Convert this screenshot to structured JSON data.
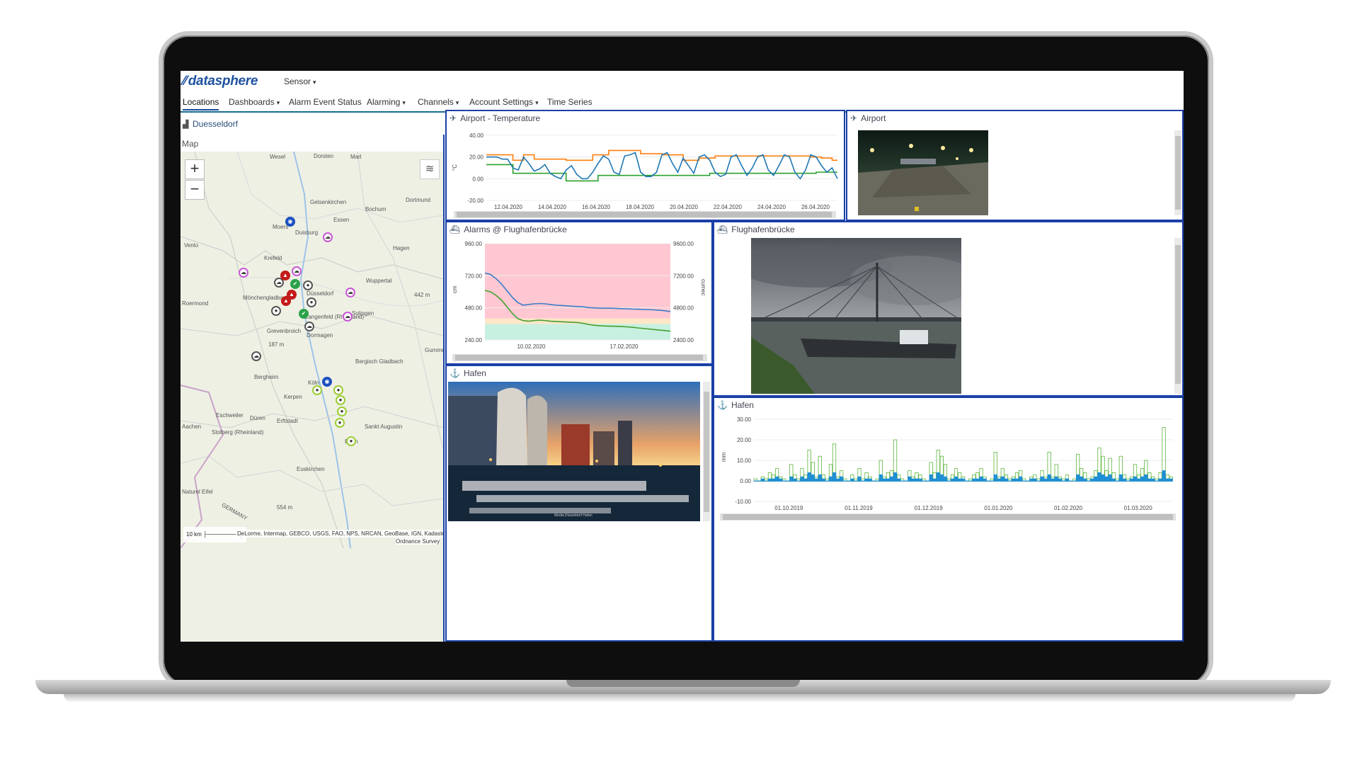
{
  "app": {
    "brand": "datasphere",
    "menu": "Sensor"
  },
  "nav": {
    "items": [
      {
        "label": "Locations"
      },
      {
        "label": "Dashboards"
      },
      {
        "label": "Alarm Event Status"
      },
      {
        "label": "Alarming"
      },
      {
        "label": "Channels"
      },
      {
        "label": "Account Settings"
      },
      {
        "label": "Time Series"
      }
    ]
  },
  "breadcrumb": {
    "location": "Duesseldorf"
  },
  "colors": {
    "accent": "#1a3fa6",
    "orange": "#ff7f0e",
    "blue": "#1f9ad6",
    "green": "#3a9a2f"
  },
  "map": {
    "title": "Map",
    "zoom_in": "+",
    "zoom_out": "−",
    "scale": "10 km",
    "attribution": "DeLorme, Intermap, GEBCO, USGS, FAO, NPS, NRCAN, GeoBase, IGN, Kadaster NL,",
    "attribution2": "Ordnance Survey",
    "places": [
      {
        "name": "Wesel"
      },
      {
        "name": "Dorsten"
      },
      {
        "name": "Marl"
      },
      {
        "name": "Gelsenkirchen"
      },
      {
        "name": "Dortmund"
      },
      {
        "name": "Essen"
      },
      {
        "name": "Bochum"
      },
      {
        "name": "Duisburg"
      },
      {
        "name": "Moers"
      },
      {
        "name": "Hagen"
      },
      {
        "name": "Krefeld"
      },
      {
        "name": "Venlo"
      },
      {
        "name": "Wuppertal"
      },
      {
        "name": "Mönchengladbach"
      },
      {
        "name": "Düsseldorf"
      },
      {
        "name": "Solingen"
      },
      {
        "name": "Langenfeld (Rheinland)"
      },
      {
        "name": "Dormagen"
      },
      {
        "name": "Grevenbroich"
      },
      {
        "name": "Bergisch Gladbach"
      },
      {
        "name": "Bergheim"
      },
      {
        "name": "Köln"
      },
      {
        "name": "Kerpen"
      },
      {
        "name": "Eschweiler"
      },
      {
        "name": "Düren"
      },
      {
        "name": "Erftstadt"
      },
      {
        "name": "Aachen"
      },
      {
        "name": "Stolberg (Rheinland)"
      },
      {
        "name": "Bonn"
      },
      {
        "name": "Sankt Augustin"
      },
      {
        "name": "Euskirchen"
      },
      {
        "name": "Gummersbach"
      },
      {
        "name": "Roermond"
      },
      {
        "name": "Naturel Eifel"
      },
      {
        "name": "GERMANY"
      },
      {
        "name": "442 m"
      },
      {
        "name": "187 m"
      },
      {
        "name": "554 m"
      }
    ]
  },
  "temperature": {
    "title": "Airport - Temperature",
    "icon": "airplane-icon"
  },
  "airport": {
    "title": "Airport",
    "icon": "airplane-icon"
  },
  "alarms": {
    "title": "Alarms @ Flughafenbrücke",
    "icon": "ship-icon"
  },
  "flughafen": {
    "title": "Flughafenbrücke",
    "icon": "ship-icon"
  },
  "hafen_image": {
    "title": "Hafen",
    "icon": "anchor-icon",
    "caption": "Media Düsseldorf Hafen"
  },
  "hafen_chart": {
    "title": "Hafen",
    "icon": "anchor-icon"
  },
  "chart_data": [
    {
      "id": "temp",
      "type": "line",
      "ylabel": "°C",
      "yticks": [
        "40.00",
        "20.00",
        "0.00",
        "-20.00"
      ],
      "ylim": [
        -20,
        40
      ],
      "xticks": [
        "12.04.2020",
        "14.04.2020",
        "16.04.2020",
        "18.04.2020",
        "20.04.2020",
        "22.04.2020",
        "24.04.2020",
        "26.04.2020"
      ],
      "series": [
        {
          "color": "#ff7f0e",
          "values": [
            22,
            22,
            22,
            22,
            22,
            17,
            17,
            22,
            22,
            18,
            18,
            18,
            18,
            18,
            18,
            17,
            17,
            17,
            17,
            17,
            22,
            22,
            22,
            26,
            26,
            26,
            26,
            26,
            26,
            23,
            23,
            23,
            23,
            22,
            22,
            22,
            22,
            17,
            17,
            17,
            19,
            19,
            19,
            21,
            21,
            21,
            21,
            21,
            21,
            21,
            21,
            21,
            21,
            21,
            21,
            21,
            21,
            21,
            21,
            21,
            21,
            20,
            20,
            19,
            19,
            17,
            17
          ]
        },
        {
          "color": "#1f77b4",
          "values": [
            20,
            20,
            20,
            18,
            18,
            10,
            8,
            20,
            14,
            7,
            9,
            13,
            5,
            2,
            0,
            8,
            12,
            4,
            0,
            0,
            6,
            14,
            21,
            18,
            6,
            4,
            21,
            22,
            24,
            6,
            2,
            2,
            6,
            22,
            24,
            14,
            6,
            19,
            12,
            5,
            20,
            22,
            17,
            6,
            2,
            4,
            20,
            22,
            12,
            3,
            10,
            20,
            22,
            8,
            3,
            12,
            22,
            20,
            6,
            0,
            8,
            22,
            20,
            12,
            6,
            10,
            0
          ]
        },
        {
          "color": "#2ca02c",
          "values": [
            13,
            13,
            13,
            13,
            13,
            5,
            5,
            5,
            5,
            5,
            5,
            5,
            5,
            5,
            5,
            -2,
            -2,
            -2,
            -2,
            -2,
            -2,
            3,
            3,
            3,
            3,
            3,
            3,
            3,
            3,
            3,
            3,
            3,
            3,
            3,
            3,
            3,
            3,
            3,
            3,
            3,
            3,
            3,
            5,
            5,
            5,
            5,
            5,
            5,
            5,
            5,
            5,
            5,
            5,
            5,
            5,
            5,
            5,
            5,
            5,
            5,
            5,
            5,
            6,
            6,
            6,
            6,
            6
          ]
        }
      ]
    },
    {
      "id": "alarms",
      "type": "area",
      "ylabel": "cm",
      "y2label": "cumec",
      "yticks": [
        "960.00",
        "720.00",
        "480.00",
        "240.00"
      ],
      "y2ticks": [
        "9600.00",
        "7200.00",
        "4800.00",
        "2400.00"
      ],
      "ylim": [
        240,
        960
      ],
      "xticks": [
        "10.02.2020",
        "17.02.2020"
      ],
      "bands": [
        {
          "from": 400,
          "to": 960,
          "color": "#ffc7d1"
        },
        {
          "from": 360,
          "to": 400,
          "color": "#ffe6c6"
        },
        {
          "from": 240,
          "to": 360,
          "color": "#c8f0e0"
        }
      ],
      "series": [
        {
          "color": "#3a7cc8",
          "values": [
            740,
            730,
            700,
            660,
            610,
            560,
            520,
            500,
            505,
            510,
            512,
            510,
            505,
            500,
            498,
            495,
            492,
            490,
            488,
            482,
            480,
            478,
            477,
            477,
            476,
            474,
            473,
            471,
            470,
            468,
            467,
            465,
            462,
            458,
            452
          ]
        },
        {
          "color": "#43a030",
          "values": [
            610,
            600,
            575,
            540,
            490,
            440,
            400,
            385,
            380,
            385,
            388,
            385,
            380,
            378,
            376,
            374,
            372,
            370,
            364,
            356,
            350,
            346,
            344,
            343,
            342,
            340,
            338,
            335,
            330,
            326,
            322,
            318,
            314,
            310,
            305
          ]
        }
      ]
    },
    {
      "id": "hafen",
      "type": "bar",
      "ylabel": "mm",
      "yticks": [
        "30.00",
        "20.00",
        "10.00",
        "0.00",
        "-10.00"
      ],
      "ylim": [
        -10,
        30
      ],
      "xticks": [
        "01.10.2019",
        "01.11.2019",
        "01.12.2019",
        "01.01.2020",
        "01.02.2020",
        "01.03.2020"
      ],
      "series": [
        {
          "color": "#5db53c",
          "values": [
            1,
            0,
            2,
            1,
            4,
            3,
            6,
            2,
            1,
            0,
            8,
            3,
            1,
            6,
            3,
            15,
            9,
            2,
            12,
            3,
            1,
            8,
            18,
            2,
            5,
            1,
            0,
            3,
            1,
            6,
            1,
            4,
            2,
            0,
            1,
            10,
            2,
            4,
            5,
            20,
            3,
            1,
            0,
            5,
            2,
            4,
            3,
            1,
            0,
            9,
            4,
            15,
            12,
            8,
            1,
            3,
            6,
            4,
            2,
            0,
            1,
            3,
            4,
            6,
            2,
            0,
            1,
            14,
            2,
            6,
            3,
            1,
            2,
            4,
            5,
            1,
            0,
            2,
            3,
            1,
            5,
            2,
            14,
            2,
            8,
            2,
            1,
            3,
            0,
            1,
            13,
            6,
            4,
            1,
            2,
            5,
            16,
            12,
            5,
            11,
            4,
            1,
            12,
            3,
            1,
            2,
            8,
            3,
            6,
            10,
            4,
            2,
            1,
            4,
            26,
            3,
            2
          ]
        },
        {
          "color": "#1f8fd6",
          "values": [
            0,
            0,
            1,
            0,
            1,
            1,
            2,
            1,
            0,
            0,
            2,
            1,
            0,
            2,
            1,
            4,
            3,
            1,
            3,
            1,
            0,
            2,
            4,
            1,
            2,
            0,
            0,
            1,
            0,
            2,
            0,
            1,
            1,
            0,
            0,
            3,
            1,
            1,
            2,
            4,
            1,
            0,
            0,
            2,
            1,
            1,
            1,
            0,
            0,
            3,
            1,
            4,
            3,
            2,
            0,
            1,
            2,
            1,
            1,
            0,
            0,
            1,
            1,
            2,
            1,
            0,
            0,
            3,
            1,
            2,
            1,
            0,
            1,
            1,
            2,
            0,
            0,
            1,
            1,
            0,
            2,
            1,
            3,
            1,
            2,
            1,
            0,
            1,
            0,
            0,
            3,
            2,
            1,
            0,
            1,
            2,
            4,
            3,
            2,
            3,
            1,
            0,
            3,
            1,
            0,
            1,
            2,
            1,
            2,
            3,
            1,
            1,
            0,
            1,
            5,
            1,
            1
          ]
        }
      ]
    }
  ]
}
